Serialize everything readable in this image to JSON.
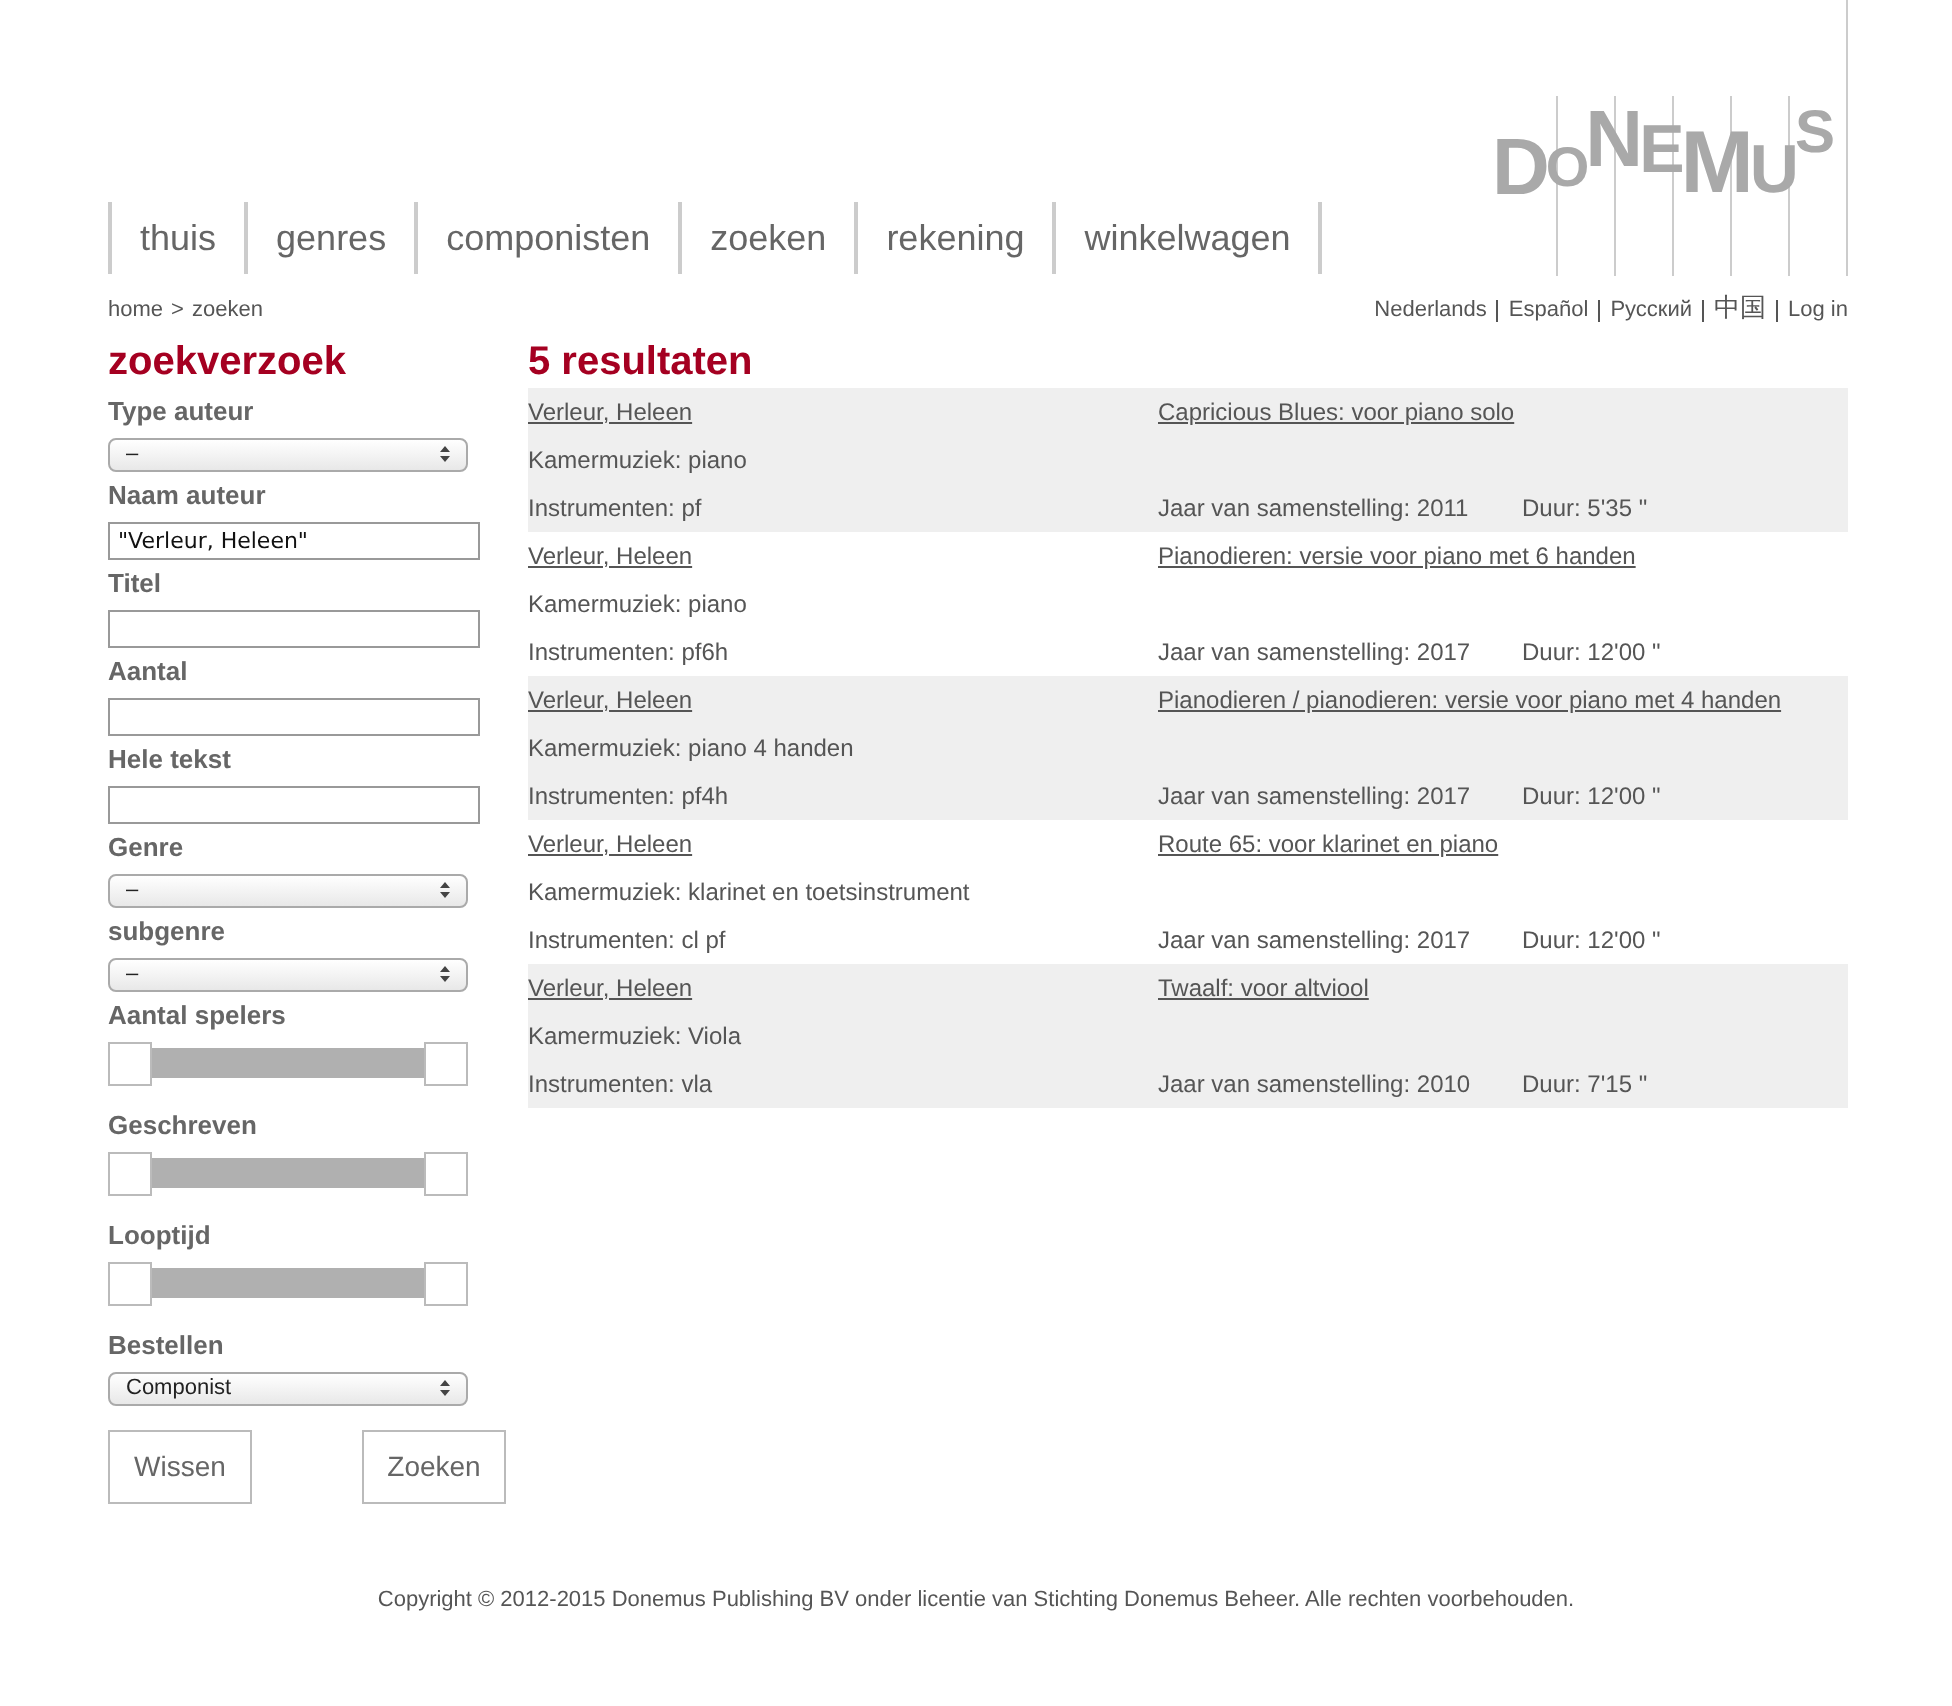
{
  "logo": "DONEMUS",
  "nav": [
    "thuis",
    "genres",
    "componisten",
    "zoeken",
    "rekening",
    "winkelwagen"
  ],
  "breadcrumb": {
    "home": "home",
    "separator": ">",
    "current": "zoeken"
  },
  "languages": [
    "Nederlands",
    "Español",
    "Русский",
    "中国",
    "Log in"
  ],
  "search": {
    "title": "zoekverzoek",
    "fields": [
      {
        "kind": "select",
        "label": "Type auteur",
        "value": "–"
      },
      {
        "kind": "text",
        "label": "Naam auteur",
        "value": "\"Verleur, Heleen\""
      },
      {
        "kind": "text",
        "label": "Titel"
      },
      {
        "kind": "text",
        "label": "Aantal"
      },
      {
        "kind": "text",
        "label": "Hele tekst"
      },
      {
        "kind": "select",
        "label": "Genre",
        "value": "–"
      },
      {
        "kind": "select",
        "label": "subgenre",
        "value": "–"
      },
      {
        "kind": "range",
        "label": "Aantal spelers",
        "level": 1
      },
      {
        "kind": "range",
        "label": "Geschreven",
        "level": 1
      },
      {
        "kind": "range",
        "label": "Looptijd",
        "level": 1
      },
      {
        "kind": "select",
        "label": "Bestellen",
        "value": "Componist"
      }
    ],
    "buttons": [
      "Wissen",
      "Zoeken"
    ]
  },
  "results": {
    "title": "5 resultaten",
    "rows": [
      {
        "composer": "Verleur, Heleen",
        "title": "Capricious Blues: voor piano solo",
        "genre": "Kamermuziek: piano",
        "instruments": "Instrumenten: pf",
        "year": "Jaar van samenstelling: 2011",
        "duration": "Duur: 5'35 \""
      },
      {
        "composer": "Verleur, Heleen",
        "title": "Pianodieren: versie voor piano met 6 handen",
        "genre": "Kamermuziek: piano",
        "instruments": "Instrumenten: pf6h",
        "year": "Jaar van samenstelling: 2017",
        "duration": "Duur: 12'00 \""
      },
      {
        "composer": "Verleur, Heleen",
        "title": "Pianodieren / pianodieren: versie voor piano met 4 handen",
        "genre": "Kamermuziek: piano 4 handen",
        "instruments": "Instrumenten: pf4h",
        "year": "Jaar van samenstelling: 2017",
        "duration": "Duur: 12'00 \""
      },
      {
        "composer": "Verleur, Heleen",
        "title": "Route 65: voor klarinet en piano",
        "genre": "Kamermuziek: klarinet en toetsinstrument",
        "instruments": "Instrumenten: cl pf",
        "year": "Jaar van samenstelling: 2017",
        "duration": "Duur: 12'00 \""
      },
      {
        "composer": "Verleur, Heleen",
        "title": "Twaalf: voor altviool",
        "genre": "Kamermuziek: Viola",
        "instruments": "Instrumenten: vla",
        "year": "Jaar van samenstelling: 2010",
        "duration": "Duur: 7'15 \""
      }
    ]
  },
  "footer": "Copyright © 2012-2015 Donemus Publishing BV onder licentie van Stichting Donemus Beheer. Alle rechten voorbehouden."
}
